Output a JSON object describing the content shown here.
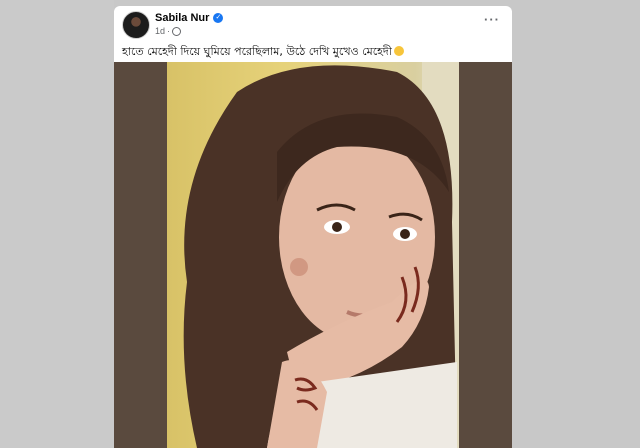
{
  "post": {
    "author": "Sabila Nur",
    "verified": true,
    "time": "1d",
    "privacy_icon": "globe-icon",
    "caption": "হাতে মেহেদী দিয়ে ঘুমিয়ে পরেছিলাম, উঠে দেখি মুখেও মেহেদী",
    "caption_emoji": "grinning-face-emoji",
    "menu_icon": "more-options-icon"
  },
  "colors": {
    "card_bg": "#ffffff",
    "page_bg": "#c8c8c8",
    "photo_bg": "#5a4a3e",
    "verified_badge": "#1877f2",
    "meta_text": "#65676b"
  }
}
